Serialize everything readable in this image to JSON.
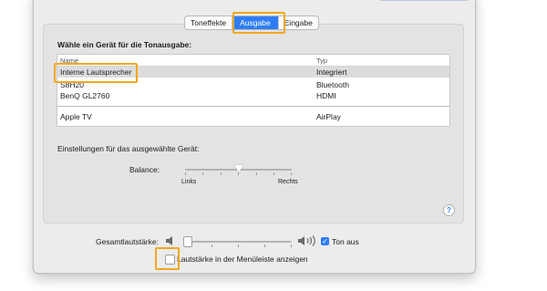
{
  "tabs": [
    {
      "label": "Toneffekte",
      "active": false
    },
    {
      "label": "Ausgabe",
      "active": true
    },
    {
      "label": "Eingabe",
      "active": false
    }
  ],
  "output": {
    "heading": "Wähle ein Gerät für die Tonausgabe:",
    "columns": {
      "name": "Name",
      "type": "Typ"
    },
    "devices": [
      {
        "name": "Interne Lautsprecher",
        "type": "Integriert",
        "selected": true
      },
      {
        "name": "S8H20",
        "type": "Bluetooth",
        "selected": false
      },
      {
        "name": "BenQ GL2760",
        "type": "HDMI",
        "selected": false
      },
      {
        "name": "Apple TV",
        "type": "AirPlay",
        "selected": false
      }
    ]
  },
  "settings": {
    "heading": "Einstellungen für das ausgewählte Gerät:",
    "balance_label": "Balance:",
    "left_label": "Links",
    "right_label": "Rechts",
    "balance_value": 0.5
  },
  "volume": {
    "label": "Gesamtlautstärke:",
    "level": 0.02,
    "mute_label": "Ton aus",
    "mute_checked": true,
    "show_in_menubar_label": "Lautstärke in der Menüleiste anzeigen",
    "show_in_menubar_checked": false
  },
  "icons": {
    "help": "?",
    "checkmark": "✓",
    "volume_low": "speaker-low-icon",
    "volume_high": "speaker-high-icon"
  },
  "colors": {
    "accent": "#2f7df6",
    "highlight": "#f0a820"
  }
}
